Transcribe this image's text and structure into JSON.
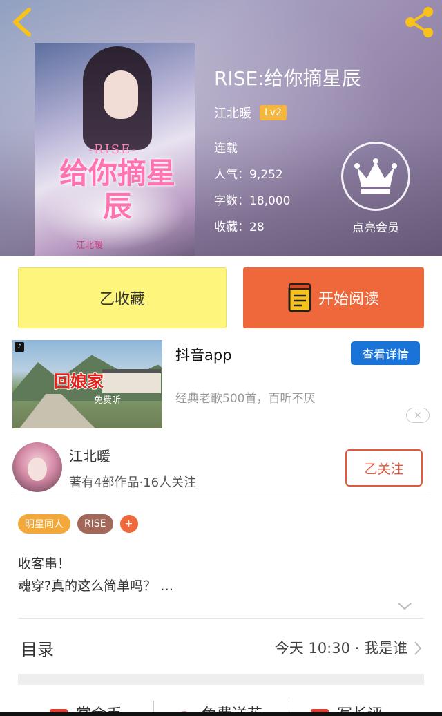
{
  "header": {
    "book_title": "RISE:给你摘星辰",
    "author": "江北暖",
    "level_badge": "Lv2",
    "status": "连载",
    "popularity": "人气：9,252",
    "word_count": "字数：18,000",
    "favorites": "收藏：28",
    "vip_label": "点亮会员"
  },
  "cover": {
    "tag": "-RISE-",
    "title": "给你摘星辰",
    "subtitle": "江北暖"
  },
  "actions": {
    "collected_label": "乙收藏",
    "read_label": "开始阅读"
  },
  "ad": {
    "thumb_title": "回娘家",
    "thumb_sub": "免费听",
    "app_name": "抖音app",
    "detail_label": "查看详情",
    "description": "经典老歌500首，百听不厌",
    "close_symbol": "×",
    "badge_symbol": "♪"
  },
  "author_card": {
    "name": "江北暖",
    "stats": "著有4部作品·16人关注",
    "follow_label": "乙关注"
  },
  "tags": [
    "明星同人",
    "RISE",
    "+"
  ],
  "intro": "收客串！\n魂穿?真的这么简单吗？ …",
  "toc": {
    "title": "目录",
    "latest": "今天 10:30 · 我是谁"
  },
  "bottom_bar": {
    "items": [
      "赏金币",
      "免费送花",
      "写长评"
    ]
  },
  "colors": {
    "accent_orange": "#ef683c",
    "collected_yellow": "#fdf57c",
    "link_blue": "#1a73d8",
    "badge_gold": "#f4b63c"
  }
}
